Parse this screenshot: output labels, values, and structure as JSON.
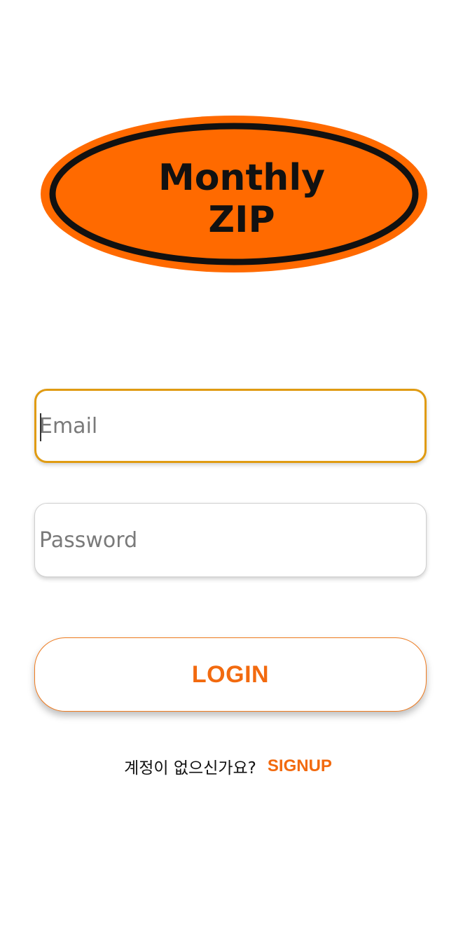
{
  "logo": {
    "line1": "Monthly",
    "line2": "ZIP",
    "fill_color": "#ff6a00",
    "ring_color": "#111111"
  },
  "form": {
    "email_placeholder": "Email",
    "email_value": "",
    "email_focused": true,
    "password_placeholder": "Password",
    "password_value": "",
    "login_label": "LOGIN"
  },
  "signup": {
    "prompt": "계정이 없으신가요?",
    "link_label": "SIGNUP"
  },
  "colors": {
    "accent": "#f26a0f",
    "focus_border": "#e09b12"
  }
}
